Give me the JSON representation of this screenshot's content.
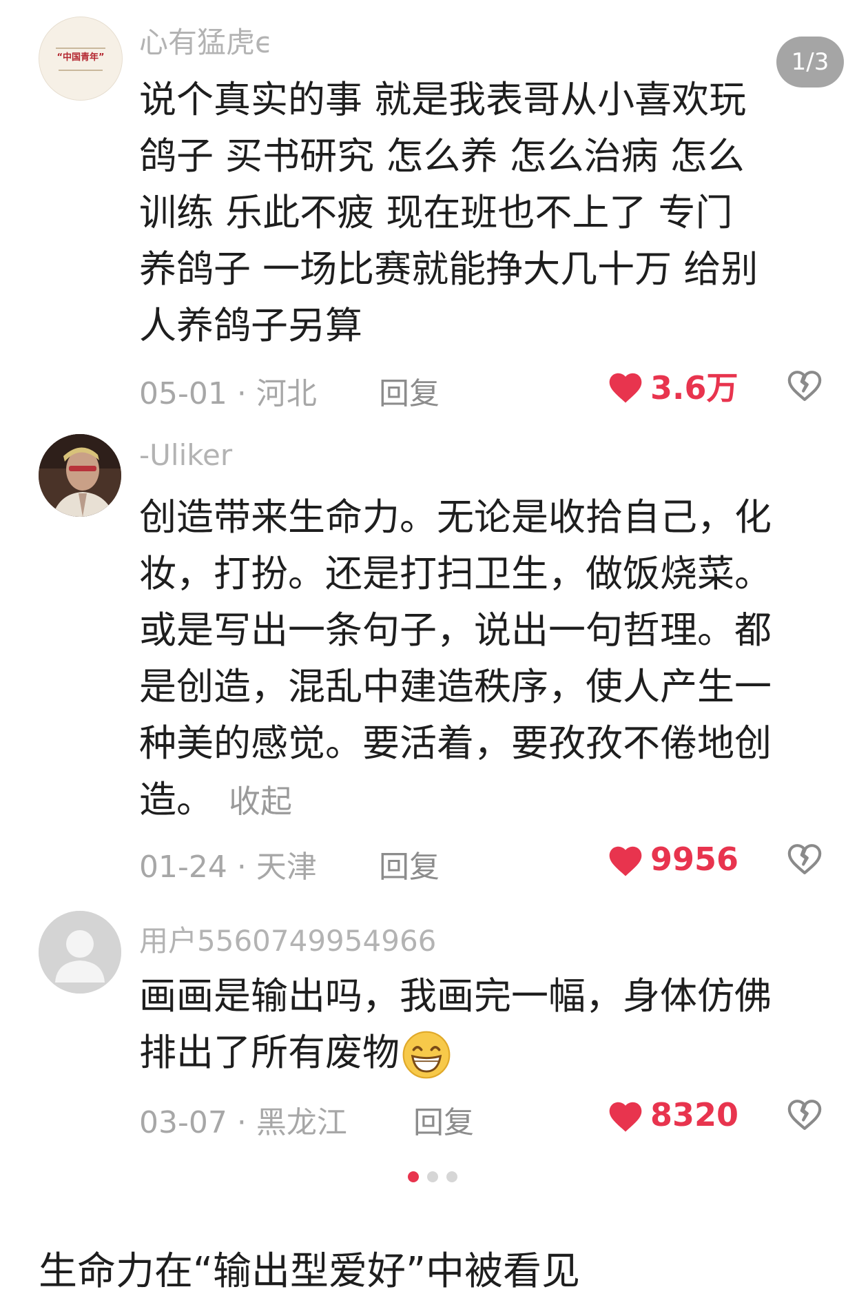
{
  "pager": {
    "label": "1/3"
  },
  "comments": [
    {
      "username": "心有猛虎ϵ",
      "avatar_text": "“中国青年”",
      "lines": [
        "说个真实的事  就是我表哥从小喜欢玩",
        "鸽子  买书研究  怎么养 怎么治病  怎么",
        "训练  乐此不疲  现在班也不上了  专门",
        "养鸽子  一场比赛就能挣大几十万  给别",
        "人养鸽子另算"
      ],
      "date": "05-01",
      "location": "河北",
      "reply": "回复",
      "likes": "3.6万"
    },
    {
      "username": "-Uliker",
      "lines": [
        "创造带来生命力。无论是收拾自己，化",
        "妆，打扮。还是打扫卫生，做饭烧菜。",
        "或是写出一条句子，说出一句哲理。都",
        "是创造，混乱中建造秩序，使人产生一",
        "种美的感觉。要活着，要孜孜不倦地创",
        "造。"
      ],
      "collapse": "收起",
      "date": "01-24",
      "location": "天津",
      "reply": "回复",
      "likes": "9956"
    },
    {
      "username": "用户5560749954966",
      "lines": [
        "画画是输出吗，我画完一幅，身体仿佛",
        "排出了所有废物"
      ],
      "date": "03-07",
      "location": "黑龙江",
      "reply": "回复",
      "likes": "8320"
    }
  ],
  "caption": "生命力在“输出型爱好”中被看见",
  "colors": {
    "like": "#e8344e",
    "meta": "#a7a7a7",
    "username": "#b3b3b3",
    "text": "#1e1e1e"
  },
  "icons": [
    "heart-icon",
    "broken-heart-icon",
    "grinning-emoji-icon",
    "default-avatar-icon"
  ]
}
